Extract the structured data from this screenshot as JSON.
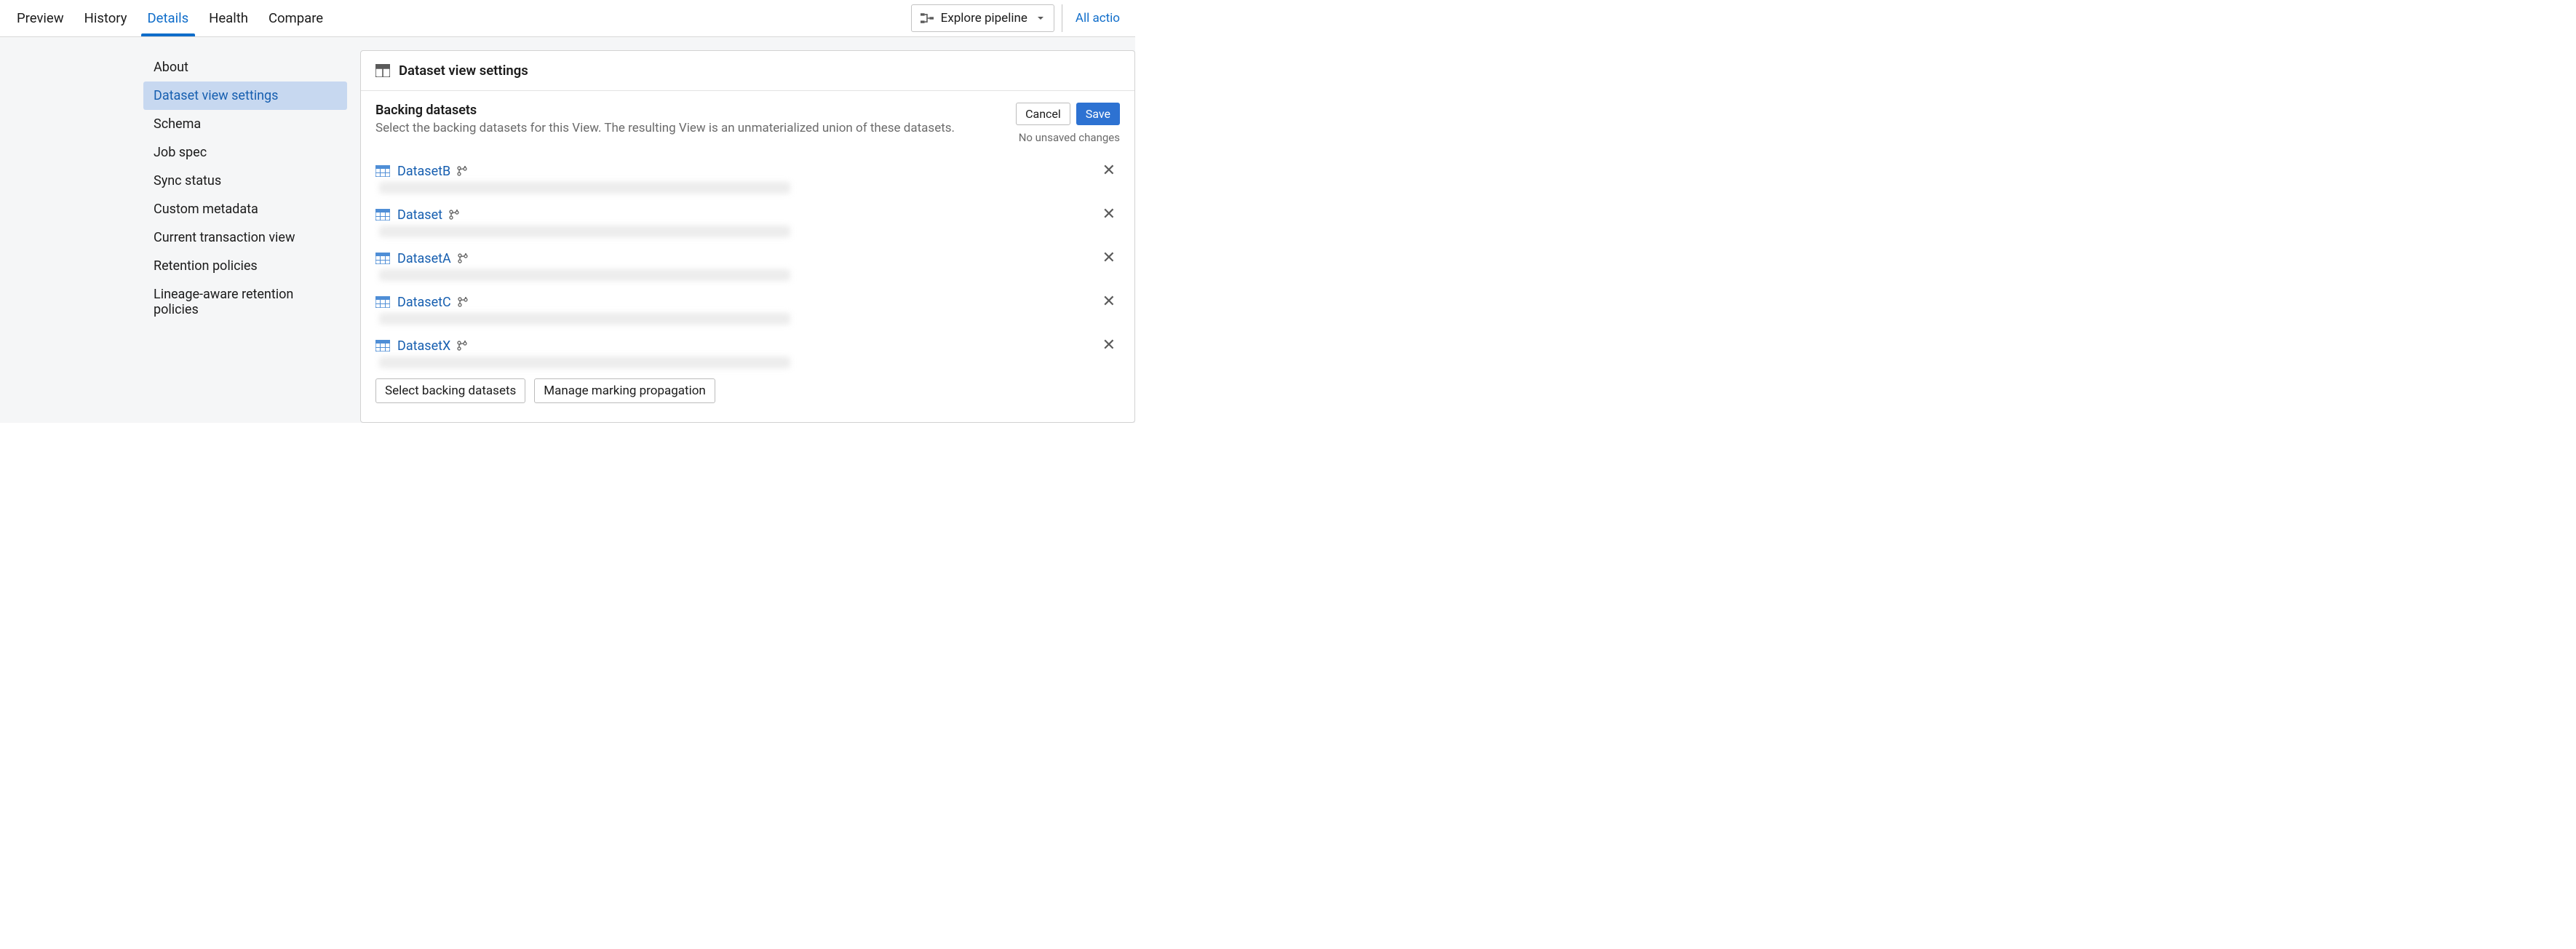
{
  "tabs": [
    {
      "label": "Preview",
      "active": false
    },
    {
      "label": "History",
      "active": false
    },
    {
      "label": "Details",
      "active": true
    },
    {
      "label": "Health",
      "active": false
    },
    {
      "label": "Compare",
      "active": false
    }
  ],
  "header": {
    "explore_label": "Explore pipeline",
    "all_actions_label": "All actio"
  },
  "sidebar": {
    "items": [
      {
        "label": "About",
        "active": false
      },
      {
        "label": "Dataset view settings",
        "active": true
      },
      {
        "label": "Schema",
        "active": false
      },
      {
        "label": "Job spec",
        "active": false
      },
      {
        "label": "Sync status",
        "active": false
      },
      {
        "label": "Custom metadata",
        "active": false
      },
      {
        "label": "Current transaction view",
        "active": false
      },
      {
        "label": "Retention policies",
        "active": false
      },
      {
        "label": "Lineage-aware retention policies",
        "active": false
      }
    ]
  },
  "panel": {
    "icon": "table-icon",
    "title": "Dataset view settings",
    "section_title": "Backing datasets",
    "section_desc": "Select the backing datasets for this View. The resulting View is an unmaterialized union of these datasets.",
    "cancel_label": "Cancel",
    "save_label": "Save",
    "unsaved_text": "No unsaved changes",
    "datasets": [
      {
        "name": "DatasetB"
      },
      {
        "name": "Dataset"
      },
      {
        "name": "DatasetA"
      },
      {
        "name": "DatasetC"
      },
      {
        "name": "DatasetX"
      }
    ],
    "select_button": "Select backing datasets",
    "manage_button": "Manage marking propagation"
  }
}
